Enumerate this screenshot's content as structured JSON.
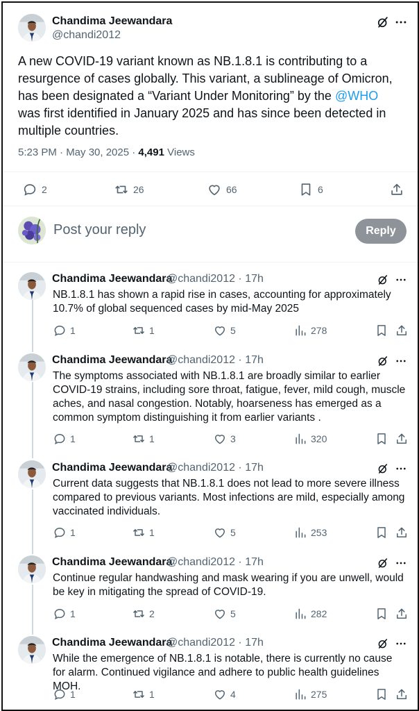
{
  "main_tweet": {
    "name": "Chandima Jeewandara",
    "handle": "@chandi2012",
    "text_before": "A new COVID-19 variant known as NB.1.8.1 is contributing to a resurgence of cases globally. This variant, a sublineage of Omicron, has been designated a “Variant Under Monitoring” by the ",
    "mention": "@WHO",
    "text_after": " was first identified in January 2025 and has since been detected in multiple countries.",
    "time": "5:23 PM · May 30, 2025 · ",
    "views_count": "4,491",
    "views_label": " Views",
    "replies": "2",
    "reposts": "26",
    "likes": "66",
    "bookmarks": "6"
  },
  "reply_box": {
    "placeholder": "Post your reply",
    "button": "Reply"
  },
  "accent_color": "#1d9bf0",
  "replies": [
    {
      "name": "Chandima Jeewandara",
      "handle": "@chandi2012 · 17h",
      "text": "NB.1.8.1 has shown a rapid rise in cases, accounting for approximately 10.7% of global sequenced cases by mid-May 2025",
      "replies": "1",
      "reposts": "1",
      "likes": "5",
      "views": "278"
    },
    {
      "name": "Chandima Jeewandara",
      "handle": "@chandi2012 · 17h",
      "text": "The symptoms associated with NB.1.8.1 are broadly similar to earlier COVID-19 strains, including sore throat, fatigue, fever, mild cough, muscle aches, and nasal congestion. Notably, hoarseness has emerged as a common symptom distinguishing it from earlier variants .",
      "replies": "1",
      "reposts": "1",
      "likes": "3",
      "views": "320"
    },
    {
      "name": "Chandima Jeewandara",
      "handle": "@chandi2012 · 17h",
      "text": "Current data suggests that NB.1.8.1 does not lead to more severe illness compared to previous variants. Most infections are mild, especially among vaccinated individuals.",
      "replies": "1",
      "reposts": "1",
      "likes": "5",
      "views": "253"
    },
    {
      "name": "Chandima Jeewandara",
      "handle": "@chandi2012 · 17h",
      "text": "Continue regular handwashing and mask wearing if you are unwell, would be key in mitigating the spread of COVID-19.",
      "replies": "1",
      "reposts": "2",
      "likes": "5",
      "views": "282"
    },
    {
      "name": "Chandima Jeewandara",
      "handle": "@chandi2012 · 17h",
      "text": "While the emergence of NB.1.8.1 is notable, there is currently no cause for alarm. Continued vigilance and adhere to public health guidelines MOH.",
      "replies": "1",
      "reposts": "1",
      "likes": "4",
      "views": "275"
    }
  ]
}
